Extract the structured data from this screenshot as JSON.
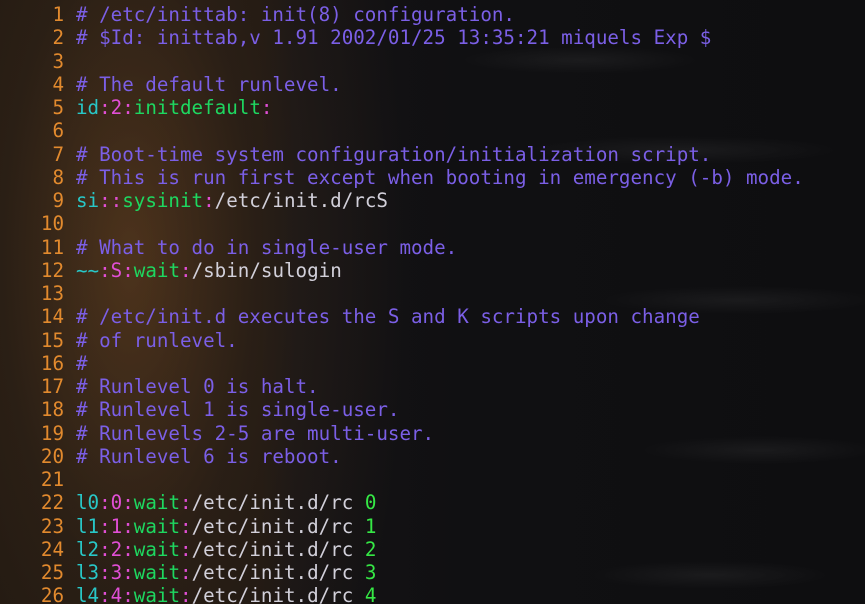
{
  "editor": {
    "accent_colors": {
      "line_number": "#e28a2e",
      "comment": "#7b5fe6",
      "identifier": "#28c7c7",
      "separator": "#e14fd6",
      "action": "#1ed760",
      "process": "#d2d0da",
      "argument": "#35e845"
    },
    "lines": [
      {
        "n": "1",
        "segments": [
          {
            "t": "# /etc/inittab: init(8) configuration.",
            "c": "comment"
          }
        ]
      },
      {
        "n": "2",
        "segments": [
          {
            "t": "# $Id: inittab,v 1.91 2002/01/25 13:35:21 miquels Exp $",
            "c": "comment"
          }
        ]
      },
      {
        "n": "3",
        "segments": []
      },
      {
        "n": "4",
        "segments": [
          {
            "t": "# The default runlevel.",
            "c": "comment"
          }
        ]
      },
      {
        "n": "5",
        "segments": [
          {
            "t": "id",
            "c": "id"
          },
          {
            "t": ":",
            "c": "colon"
          },
          {
            "t": "2",
            "c": "lvl"
          },
          {
            "t": ":",
            "c": "colon"
          },
          {
            "t": "initdefault",
            "c": "action"
          },
          {
            "t": ":",
            "c": "colon"
          }
        ]
      },
      {
        "n": "6",
        "segments": []
      },
      {
        "n": "7",
        "segments": [
          {
            "t": "# Boot-time system configuration/initialization script.",
            "c": "comment"
          }
        ]
      },
      {
        "n": "8",
        "segments": [
          {
            "t": "# This is run first except when booting in emergency (-b) mode.",
            "c": "comment"
          }
        ]
      },
      {
        "n": "9",
        "segments": [
          {
            "t": "si",
            "c": "id"
          },
          {
            "t": "::",
            "c": "colon"
          },
          {
            "t": "sysinit",
            "c": "action"
          },
          {
            "t": ":",
            "c": "colon"
          },
          {
            "t": "/etc/init.d/rcS",
            "c": "process"
          }
        ]
      },
      {
        "n": "10",
        "segments": []
      },
      {
        "n": "11",
        "segments": [
          {
            "t": "# What to do in single-user mode.",
            "c": "comment"
          }
        ]
      },
      {
        "n": "12",
        "segments": [
          {
            "t": "~~",
            "c": "id"
          },
          {
            "t": ":",
            "c": "colon"
          },
          {
            "t": "S",
            "c": "lvl"
          },
          {
            "t": ":",
            "c": "colon"
          },
          {
            "t": "wait",
            "c": "action"
          },
          {
            "t": ":",
            "c": "colon"
          },
          {
            "t": "/sbin/sulogin",
            "c": "process"
          }
        ]
      },
      {
        "n": "13",
        "segments": []
      },
      {
        "n": "14",
        "segments": [
          {
            "t": "# /etc/init.d executes the S and K scripts upon change",
            "c": "comment"
          }
        ]
      },
      {
        "n": "15",
        "segments": [
          {
            "t": "# of runlevel.",
            "c": "comment"
          }
        ]
      },
      {
        "n": "16",
        "segments": [
          {
            "t": "#",
            "c": "comment"
          }
        ]
      },
      {
        "n": "17",
        "segments": [
          {
            "t": "# Runlevel 0 is halt.",
            "c": "comment"
          }
        ]
      },
      {
        "n": "18",
        "segments": [
          {
            "t": "# Runlevel 1 is single-user.",
            "c": "comment"
          }
        ]
      },
      {
        "n": "19",
        "segments": [
          {
            "t": "# Runlevels 2-5 are multi-user.",
            "c": "comment"
          }
        ]
      },
      {
        "n": "20",
        "segments": [
          {
            "t": "# Runlevel 6 is reboot.",
            "c": "comment"
          }
        ]
      },
      {
        "n": "21",
        "segments": []
      },
      {
        "n": "22",
        "segments": [
          {
            "t": "l0",
            "c": "id"
          },
          {
            "t": ":",
            "c": "colon"
          },
          {
            "t": "0",
            "c": "lvl"
          },
          {
            "t": ":",
            "c": "colon"
          },
          {
            "t": "wait",
            "c": "action"
          },
          {
            "t": ":",
            "c": "colon"
          },
          {
            "t": "/etc/init.d/rc ",
            "c": "process"
          },
          {
            "t": "0",
            "c": "arg"
          }
        ]
      },
      {
        "n": "23",
        "segments": [
          {
            "t": "l1",
            "c": "id"
          },
          {
            "t": ":",
            "c": "colon"
          },
          {
            "t": "1",
            "c": "lvl"
          },
          {
            "t": ":",
            "c": "colon"
          },
          {
            "t": "wait",
            "c": "action"
          },
          {
            "t": ":",
            "c": "colon"
          },
          {
            "t": "/etc/init.d/rc ",
            "c": "process"
          },
          {
            "t": "1",
            "c": "arg"
          }
        ]
      },
      {
        "n": "24",
        "segments": [
          {
            "t": "l2",
            "c": "id"
          },
          {
            "t": ":",
            "c": "colon"
          },
          {
            "t": "2",
            "c": "lvl"
          },
          {
            "t": ":",
            "c": "colon"
          },
          {
            "t": "wait",
            "c": "action"
          },
          {
            "t": ":",
            "c": "colon"
          },
          {
            "t": "/etc/init.d/rc ",
            "c": "process"
          },
          {
            "t": "2",
            "c": "arg"
          }
        ]
      },
      {
        "n": "25",
        "segments": [
          {
            "t": "l3",
            "c": "id"
          },
          {
            "t": ":",
            "c": "colon"
          },
          {
            "t": "3",
            "c": "lvl"
          },
          {
            "t": ":",
            "c": "colon"
          },
          {
            "t": "wait",
            "c": "action"
          },
          {
            "t": ":",
            "c": "colon"
          },
          {
            "t": "/etc/init.d/rc ",
            "c": "process"
          },
          {
            "t": "3",
            "c": "arg"
          }
        ]
      },
      {
        "n": "26",
        "segments": [
          {
            "t": "l4",
            "c": "id"
          },
          {
            "t": ":",
            "c": "colon"
          },
          {
            "t": "4",
            "c": "lvl"
          },
          {
            "t": ":",
            "c": "colon"
          },
          {
            "t": "wait",
            "c": "action"
          },
          {
            "t": ":",
            "c": "colon"
          },
          {
            "t": "/etc/init.d/rc ",
            "c": "process"
          },
          {
            "t": "4",
            "c": "arg"
          }
        ]
      }
    ]
  }
}
